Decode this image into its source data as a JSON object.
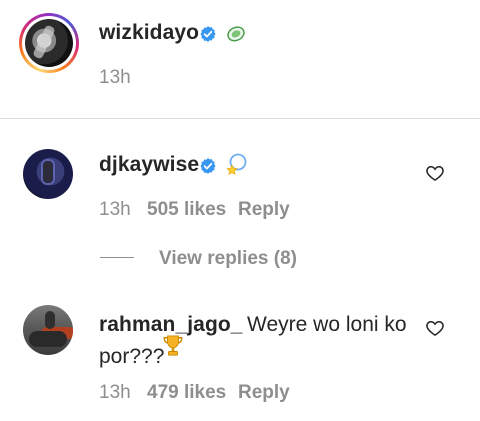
{
  "caption": {
    "username": "wizkidayo",
    "emoji": "🥏",
    "time": "13h"
  },
  "comments": [
    {
      "username": "djkaywise",
      "emoji": "💫",
      "time": "13h",
      "likes": "505 likes",
      "reply_label": "Reply",
      "view_replies": "View replies (8)"
    },
    {
      "username": "rahman_jago_",
      "text_line1": "Weyre wo loni ko",
      "text_line2": "por???",
      "emoji": "🏆",
      "time": "13h",
      "likes": "479 likes",
      "reply_label": "Reply"
    }
  ],
  "icons": {
    "verified": "verified-badge-icon",
    "like": "heart-outline-icon"
  },
  "colors": {
    "text": "#262626",
    "muted": "#8e8e8e",
    "verified": "#3897f0",
    "divider": "#dbdbdb"
  }
}
